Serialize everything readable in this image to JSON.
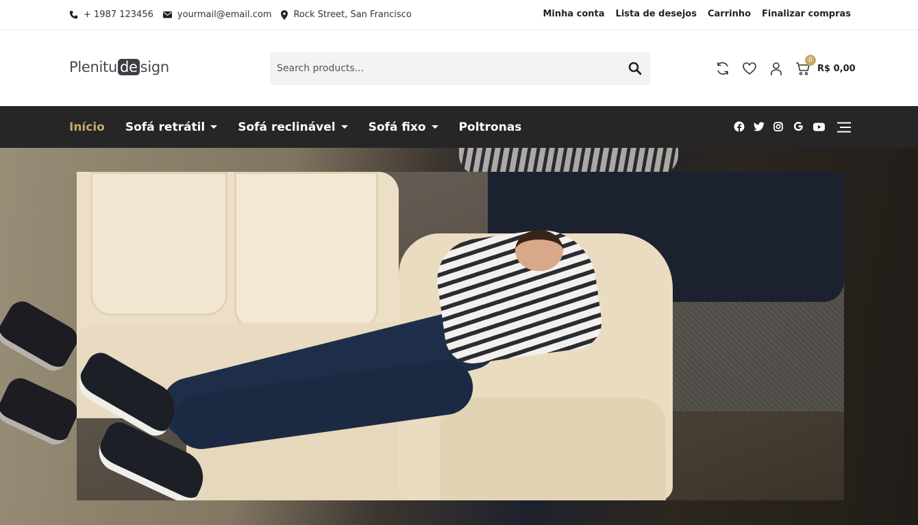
{
  "topbar": {
    "phone": "+ 1987 123456",
    "email": "yourmail@email.com",
    "address": "Rock Street, San Francisco",
    "links": [
      "Minha conta",
      "Lista de desejos",
      "Carrinho",
      "Finalizar compras"
    ]
  },
  "header": {
    "logo": {
      "pre": "Plenitu",
      "highlight": "de",
      "post": "sign"
    },
    "search_placeholder": "Search products...",
    "cart": {
      "count": "0",
      "amount": "R$ 0,00"
    }
  },
  "nav": {
    "items": [
      {
        "label": "Início",
        "active": true,
        "dropdown": false
      },
      {
        "label": "Sofá retrátil",
        "active": false,
        "dropdown": true
      },
      {
        "label": "Sofá reclinável",
        "active": false,
        "dropdown": true
      },
      {
        "label": "Sofá fixo",
        "active": false,
        "dropdown": true
      },
      {
        "label": "Poltronas",
        "active": false,
        "dropdown": false
      }
    ],
    "social": [
      "facebook-icon",
      "twitter-icon",
      "instagram-icon",
      "google-icon",
      "youtube-icon"
    ]
  },
  "colors": {
    "accent": "#c8a96a",
    "nav_bg": "#262626",
    "search_bg": "#f3f3f3"
  }
}
